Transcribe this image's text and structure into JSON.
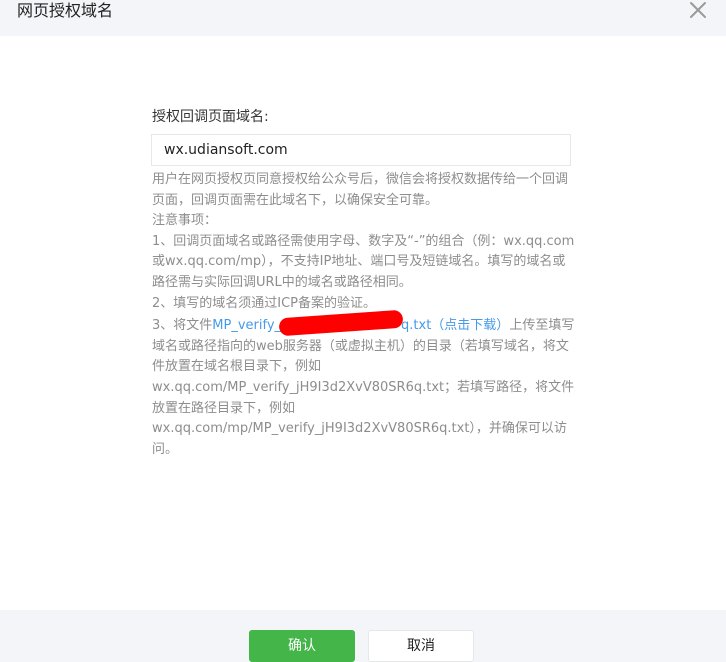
{
  "dialog": {
    "title": "网页授权域名",
    "close_icon": "close-icon"
  },
  "form": {
    "label": "授权回调页面域名:",
    "domain_value": "wx.udiansoft.com"
  },
  "description": {
    "intro": "用户在网页授权页同意授权给公众号后，微信会将授权数据传给一个回调页面，回调页面需在此域名下，以确保安全可靠。",
    "notes_title": "注意事项：",
    "note1": "1、回调页面域名或路径需使用字母、数字及“-”的组合（例：wx.qq.com或wx.qq.com/mp），不支持IP地址、端口号及短链域名。填写的域名或路径需与实际回调URL中的域名或路径相同。",
    "note2": "2、填写的域名须通过ICP备案的验证。",
    "note3_prefix": "3、将文件",
    "note3_file_start": "MP_verify_",
    "note3_file_end": "q.txt（点击下载）",
    "note3_rest": "上传至填写域名或路径指向的web服务器（或虚拟主机）的目录（若填写域名，将文件放置在域名根目录下，例如wx.qq.com/MP_verify_jH9I3d2XvV80SR6q.txt；若填写路径，将文件放置在路径目录下，例如wx.qq.com/mp/MP_verify_jH9I3d2XvV80SR6q.txt），并确保可以访问。"
  },
  "footer": {
    "confirm_label": "确认",
    "cancel_label": "取消"
  },
  "colors": {
    "primary": "#44b549",
    "link": "#459ae9",
    "header_bg": "#f4f5f9",
    "muted_text": "#8d8d8d"
  }
}
